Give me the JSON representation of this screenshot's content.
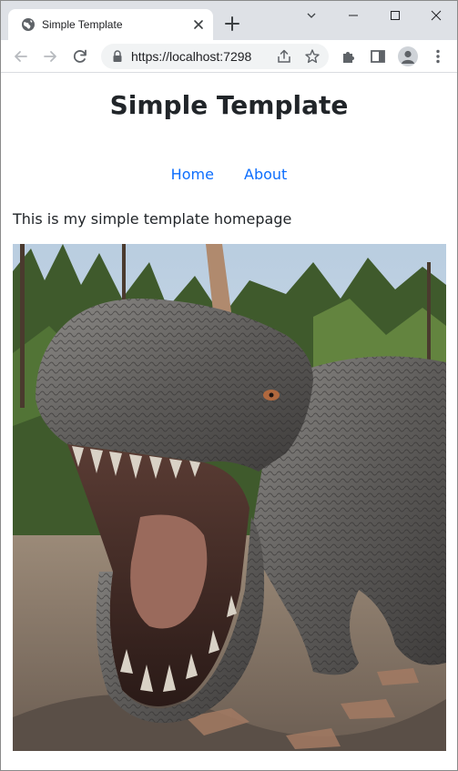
{
  "browser": {
    "tab_title": "Simple Template",
    "url": "https://localhost:7298"
  },
  "page": {
    "site_title": "Simple Template",
    "nav": [
      {
        "label": "Home"
      },
      {
        "label": "About"
      }
    ],
    "intro_text": "This is my simple template homepage",
    "hero_image": {
      "icon": "dinosaur-image"
    }
  },
  "colors": {
    "tab_strip": "#dee1e6",
    "link": "#0d6efd",
    "text": "#212529"
  }
}
